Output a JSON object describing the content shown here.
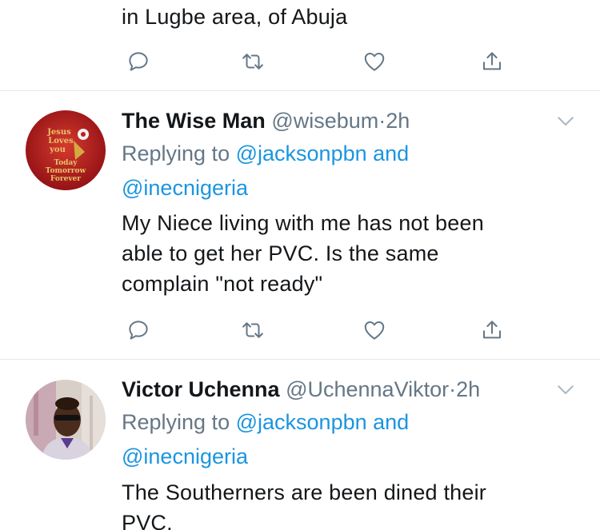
{
  "top_tweet": {
    "text_tail": "in Lugbe area, of Abuja"
  },
  "tweets": [
    {
      "name": "The Wise Man",
      "handle": "@wisebum",
      "separator": "·",
      "time": "2h",
      "replying_prefix": "Replying to",
      "replying_user1": "@jacksonpbn",
      "replying_and": "and",
      "replying_user2": "@inecnigeria",
      "text_line1": "My Niece living with me has not been",
      "text_line2": "able to get her PVC. Is the same",
      "text_line3": "complain \"not ready\"",
      "avatar": {
        "line1": "Jesus",
        "line2": "Loves",
        "line3": "you",
        "line4": "Today",
        "line5": "Tomorrow",
        "line6": "Forever",
        "bg_color": "#b8171d"
      }
    },
    {
      "name": "Victor Uchenna",
      "handle": "@UchennaViktor",
      "separator": "·",
      "time": "2h",
      "replying_prefix": "Replying to",
      "replying_user1": "@jacksonpbn",
      "replying_and": "and",
      "replying_user2": "@inecnigeria",
      "text_line1": "The Southerners are been dined their",
      "text_line2": "PVC."
    }
  ],
  "icons": {
    "reply": "reply-icon",
    "retweet": "retweet-icon",
    "like": "heart-icon",
    "share": "share-icon",
    "menu": "chevron-down-icon"
  },
  "colors": {
    "text": "#14171a",
    "secondary": "#657786",
    "link": "#1b95e0",
    "divider": "#e1e8ed"
  }
}
